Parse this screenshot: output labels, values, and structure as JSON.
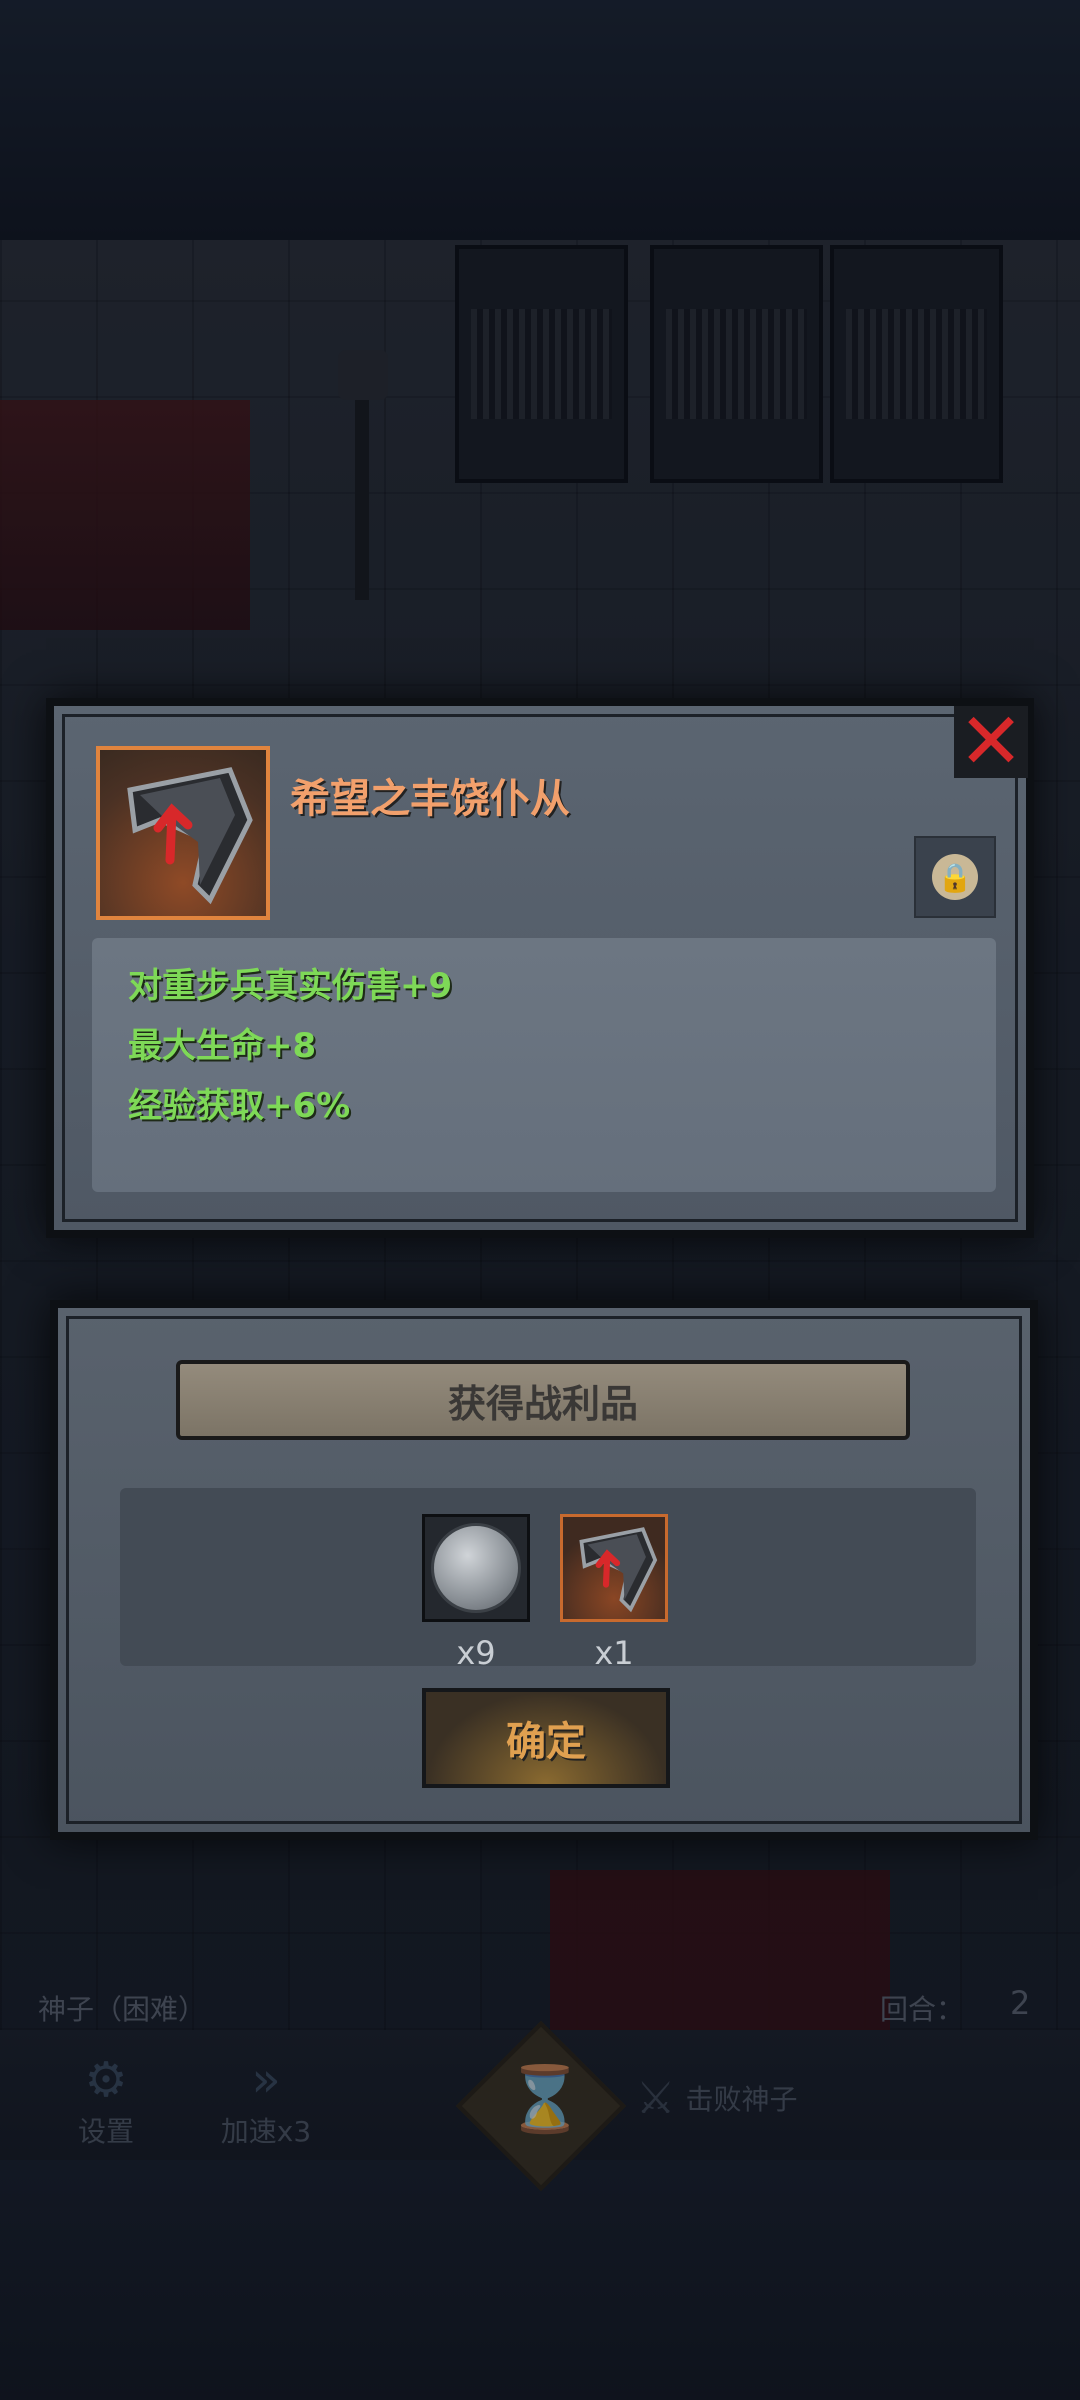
{
  "item": {
    "name": "希望之丰饶仆从",
    "icon": "weapon-blade-icon",
    "stats": [
      "对重步兵真实伤害+9",
      "最大生命+8",
      "经验获取+6%"
    ],
    "close_icon": "close-icon",
    "lock_icon": "lock-icon"
  },
  "loot": {
    "title": "获得战利品",
    "items": [
      {
        "icon": "silver-coin-icon",
        "count": "x9"
      },
      {
        "icon": "weapon-blade-icon",
        "count": "x1"
      }
    ],
    "confirm_label": "确定"
  },
  "hud": {
    "stage_label": "神子（困难）",
    "round_label": "回合：",
    "round_value": "2",
    "settings_label": "设置",
    "speed_label": "加速x3",
    "objective_label": "击败神子"
  },
  "colors": {
    "item_name": "#f2a06c",
    "stat_text": "#7ed957",
    "close_x": "#d8282a",
    "confirm_text": "#e0a050"
  }
}
